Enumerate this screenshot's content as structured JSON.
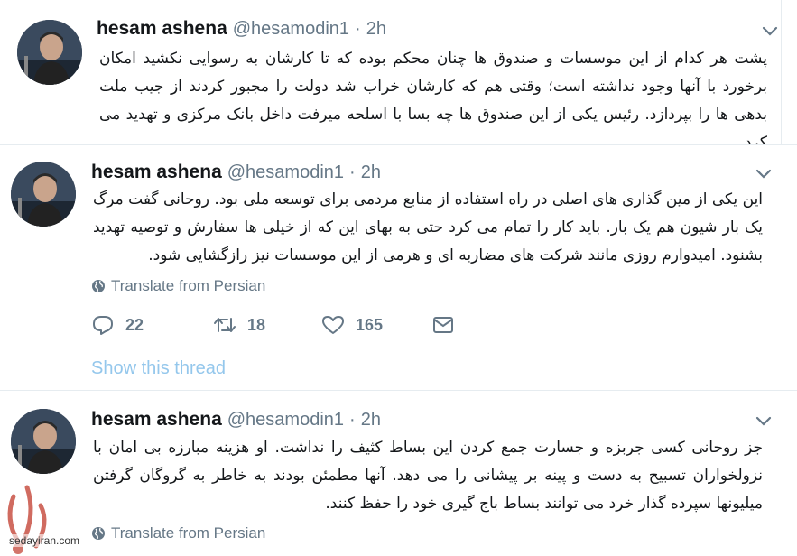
{
  "tweets": [
    {
      "name": "hesam ashena",
      "handle": "@hesamodin1",
      "dot": "·",
      "time": "2h",
      "text": "پشت هر کدام از این موسسات و صندوق ها چنان محکم بوده که تا کارشان به رسوایی نکشید امکان برخورد با آنها وجود نداشته است؛ وقتی هم که کارشان خراب شد دولت را مجبور کردند از جیب ملت بدهی ها را بپردازد. رئیس یکی از این صندوق ها چه بسا با اسلحه میرفت داخل بانک مرکزی و تهدید می کرد."
    },
    {
      "name": "hesam ashena",
      "handle": "@hesamodin1",
      "dot": "·",
      "time": "2h",
      "text": "این یکی از مین گذاری های اصلی در راه استفاده از منابع مردمی برای توسعه ملی بود. روحانی گفت مرگ یک بار شیون هم یک بار. باید کار را تمام می کرد حتی به بهای این که از خیلی ها سفارش و توصیه تهدید بشنود. امیدوارم روزی مانند شرکت های مضاربه ای و هرمی از این موسسات نیز رازگشایی شود.",
      "translate": "Translate from Persian",
      "actions": {
        "replies": "22",
        "retweets": "18",
        "likes": "165"
      },
      "thread_link": "Show this thread"
    },
    {
      "name": "hesam ashena",
      "handle": "@hesamodin1",
      "dot": "·",
      "time": "2h",
      "text": "جز روحانی کسی جربزه و جسارت جمع کردن این بساط کثیف را نداشت. او هزینه مبارزه بی امان با نزولخواران تسبیح به دست و پینه بر پیشانی را می دهد. آنها مطمئن بودند به خاطر به گروگان گرفتن میلیونها سپرده گذار خرد می توانند بساط باج گیری خود را حفظ کنند.",
      "translate": "Translate from Persian"
    }
  ],
  "watermark": {
    "site": "sedayiran.com"
  },
  "icons": [
    "avatar",
    "chevron-down-icon",
    "globe-icon",
    "reply-icon",
    "retweet-icon",
    "like-icon",
    "message-icon"
  ],
  "colors": {
    "link": "#94c7ec",
    "secondary": "#657786",
    "border": "#e6ecf0"
  }
}
